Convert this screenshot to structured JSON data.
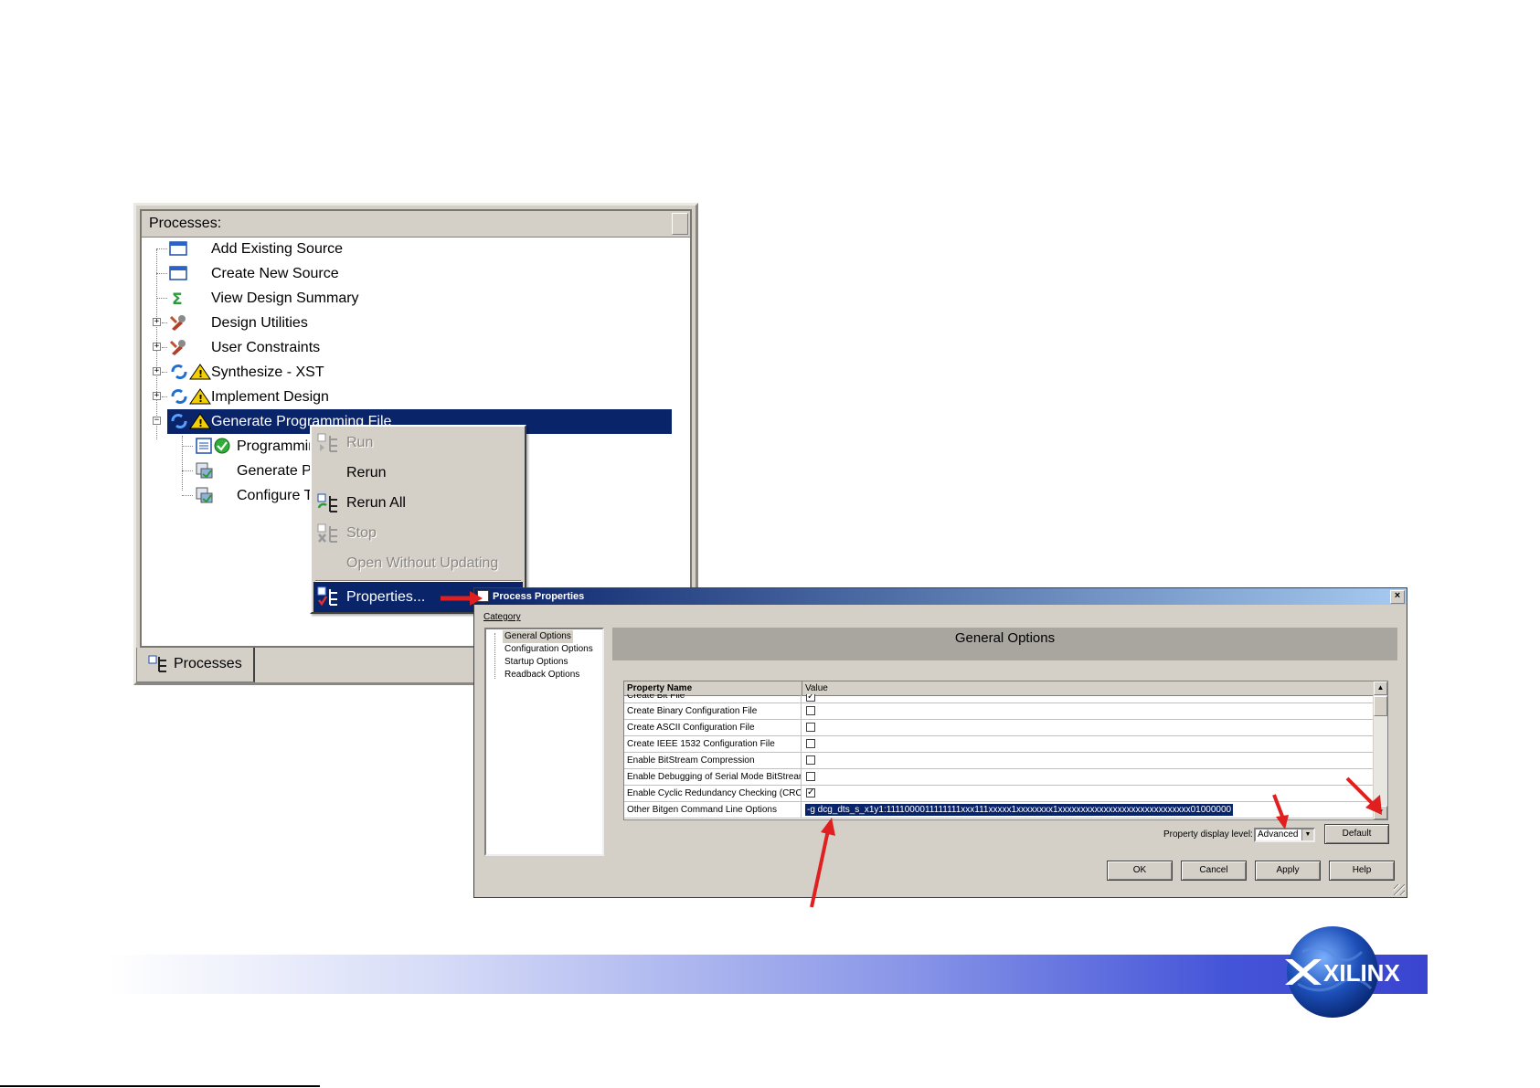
{
  "processes_panel": {
    "header": "Processes:",
    "tab_label": "Processes",
    "items": [
      {
        "label": "Add Existing Source",
        "icon": "source-window-icon"
      },
      {
        "label": "Create New Source",
        "icon": "source-window-icon"
      },
      {
        "label": "View Design Summary",
        "icon": "sigma-icon"
      },
      {
        "label": "Design Utilities",
        "icon": "tools-icon"
      },
      {
        "label": "User Constraints",
        "icon": "tools-icon"
      },
      {
        "label": "Synthesize - XST",
        "icon": "refresh-warning-icon"
      },
      {
        "label": "Implement Design",
        "icon": "refresh-warning-icon"
      },
      {
        "label": "Generate Programming File",
        "icon": "refresh-warning-icon"
      },
      {
        "label": "Programming File Generation Report",
        "icon": "report-ok-icon"
      },
      {
        "label": "Generate PROM, ACE, or JTAG File",
        "icon": "chip-icon"
      },
      {
        "label": "Configure Target Device",
        "icon": "chip-icon"
      }
    ]
  },
  "context_menu": {
    "items": [
      {
        "label": "Run",
        "enabled": false
      },
      {
        "label": "Rerun",
        "enabled": true
      },
      {
        "label": "Rerun All",
        "enabled": true
      },
      {
        "label": "Stop",
        "enabled": false
      },
      {
        "label": "Open Without Updating",
        "enabled": false
      },
      {
        "label": "Properties...",
        "enabled": true
      }
    ]
  },
  "dialog": {
    "title": "Process Properties",
    "category_label": "Category",
    "categories": [
      "General Options",
      "Configuration Options",
      "Startup Options",
      "Readback Options"
    ],
    "section_title": "General Options",
    "grid": {
      "col_name": "Property Name",
      "col_value": "Value",
      "rows": [
        {
          "name": "Create Bit File",
          "type": "checkbox",
          "checked": true
        },
        {
          "name": "Create Binary Configuration File",
          "type": "checkbox",
          "checked": false
        },
        {
          "name": "Create ASCII Configuration File",
          "type": "checkbox",
          "checked": false
        },
        {
          "name": "Create IEEE 1532 Configuration File",
          "type": "checkbox",
          "checked": false
        },
        {
          "name": "Enable BitStream Compression",
          "type": "checkbox",
          "checked": false
        },
        {
          "name": "Enable Debugging of Serial Mode BitStream",
          "type": "checkbox",
          "checked": false
        },
        {
          "name": "Enable Cyclic Redundancy Checking (CRC)",
          "type": "checkbox",
          "checked": true
        },
        {
          "name": "Other Bitgen Command Line Options",
          "type": "text",
          "value": "-g dcg_dts_s_x1y1:1111000011111111xxx111xxxxx1xxxxxxxx1xxxxxxxxxxxxxxxxxxxxxxxxxxxxx01000000"
        }
      ]
    },
    "display_level_label": "Property display level:",
    "display_level_value": "Advanced",
    "buttons": {
      "default": "Default",
      "ok": "OK",
      "cancel": "Cancel",
      "apply": "Apply",
      "help": "Help"
    }
  },
  "footer": {
    "logo_text": "XILINX",
    "colors": {
      "accent": "#3a44d0",
      "selection": "#0a246a",
      "arrow": "#e02020"
    }
  }
}
